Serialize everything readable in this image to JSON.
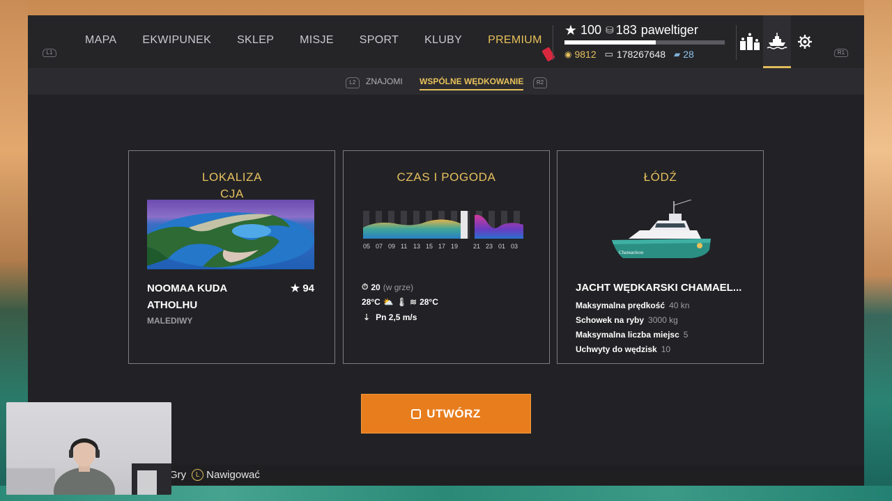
{
  "nav": {
    "left_hint": "L1",
    "right_hint": "R1",
    "items": [
      "MAPA",
      "EKWIPUNEK",
      "SKLEP",
      "MISJE",
      "SPORT",
      "KLUBY",
      "PREMIUM"
    ]
  },
  "player": {
    "level": "100",
    "rank": "183",
    "name": "paweltiger",
    "xp_progress": 0.57,
    "silver": "9812",
    "credits": "178267648",
    "gold": "28"
  },
  "icons": [
    "leaderboard-icon",
    "boat-icon",
    "gear-icon"
  ],
  "subtabs": {
    "left_hint": "L2",
    "right_hint": "R2",
    "items": [
      "ZNAJOMI",
      "WSPÓLNE WĘDKOWANIE"
    ],
    "active": 1
  },
  "location": {
    "title_line1": "LOKALIZA",
    "title_line2": "CJA",
    "name_line1": "NOOMAA KUDA",
    "name_line2": "ATHOLHU",
    "rating": "94",
    "country": "MALEDIWY"
  },
  "weather": {
    "title": "CZAS I POGODA",
    "hours": [
      "05",
      "07",
      "09",
      "11",
      "13",
      "15",
      "17",
      "19",
      "21",
      "23",
      "01",
      "03"
    ],
    "time": "20",
    "time_note": "(w grze)",
    "air_temp": "28°C",
    "water_temp": "28°C",
    "wind": "Pn 2,5 m/s"
  },
  "boat": {
    "title": "ŁÓDŹ",
    "name": "JACHT WĘDKARSKI CHAMAEL...",
    "hull_text": "Chamaeleon",
    "specs": [
      {
        "label": "Maksymalna prędkość",
        "value": "40 kn"
      },
      {
        "label": "Schowek na ryby",
        "value": "3000 kg"
      },
      {
        "label": "Maksymalna liczba miejsc",
        "value": "5"
      },
      {
        "label": "Uchwyty do wędzisk",
        "value": "10"
      }
    ]
  },
  "create_button": "UTWÓRZ",
  "hints": {
    "partial": "Gry",
    "navigate_key": "L",
    "navigate": "Nawigować"
  }
}
